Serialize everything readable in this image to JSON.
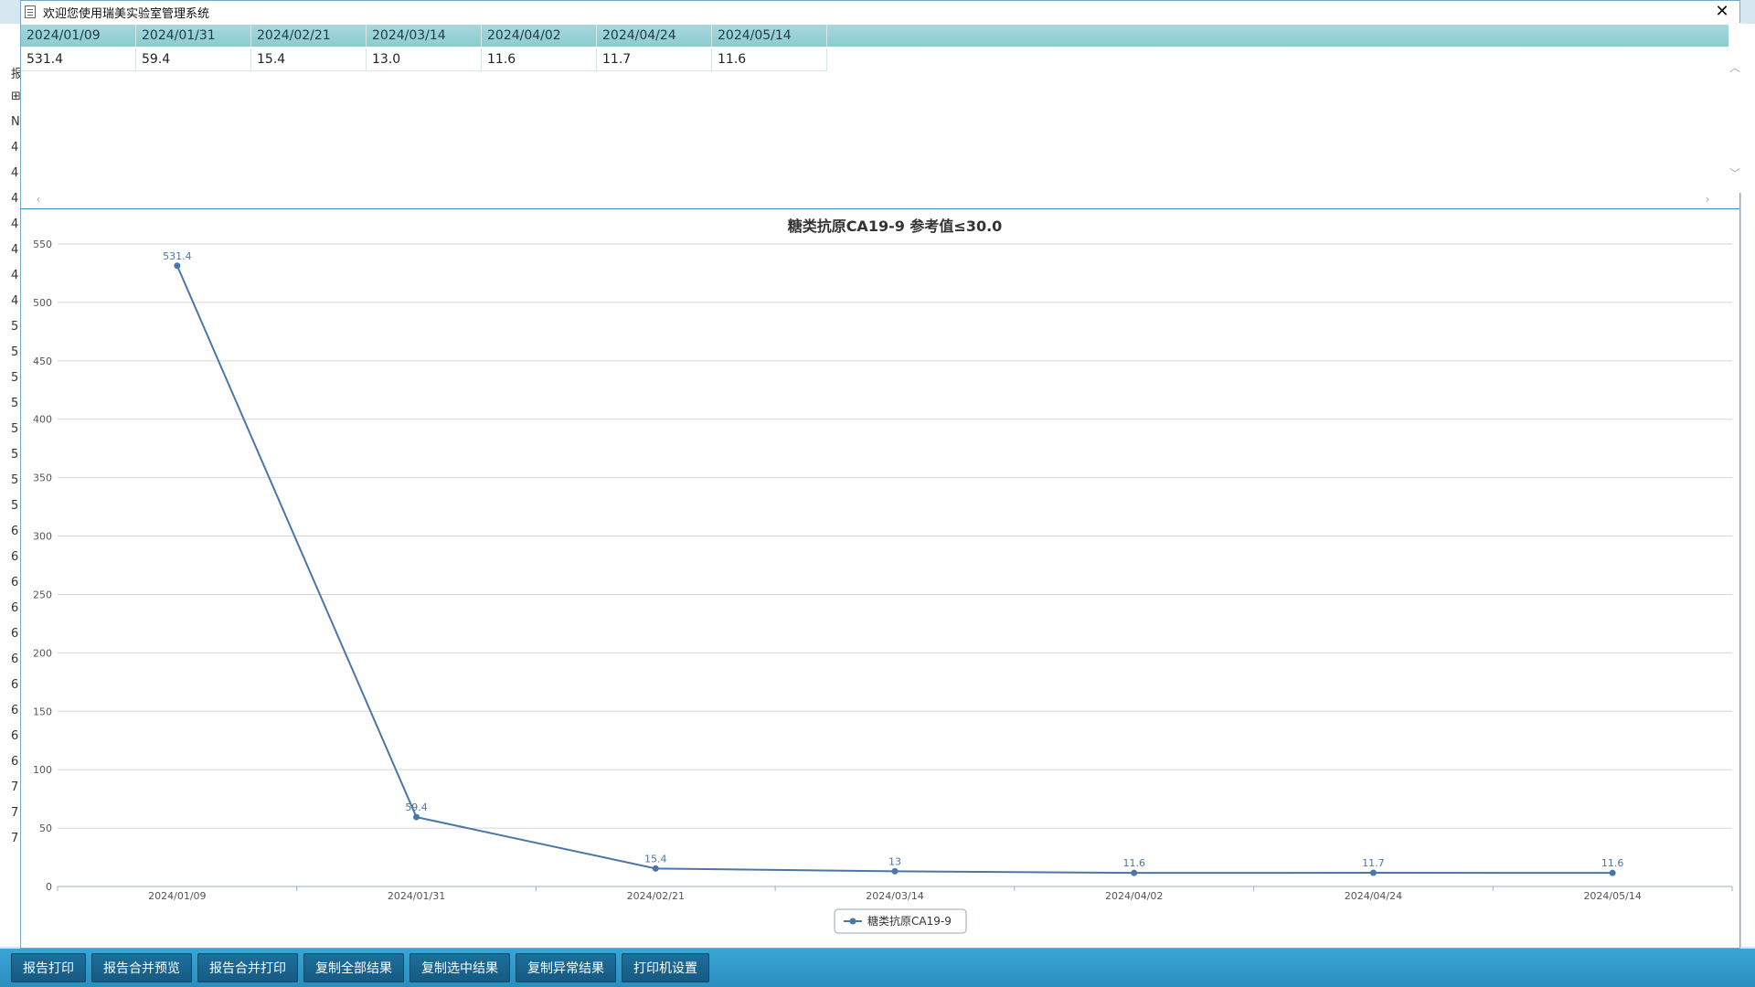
{
  "dialog": {
    "title": "欢迎您使用瑞美实验室管理系统",
    "close_glyph": "✕"
  },
  "table": {
    "columns": [
      "2024/01/09",
      "2024/01/31",
      "2024/02/21",
      "2024/03/14",
      "2024/04/02",
      "2024/04/24",
      "2024/05/14"
    ],
    "rows": [
      [
        "531.4",
        "59.4",
        "15.4",
        "13.0",
        "11.6",
        "11.7",
        "11.6"
      ]
    ]
  },
  "chart_data": {
    "type": "line",
    "title": "糖类抗原CA19-9 参考值≤30.0",
    "categories": [
      "2024/01/09",
      "2024/01/31",
      "2024/02/21",
      "2024/03/14",
      "2024/04/02",
      "2024/04/24",
      "2024/05/14"
    ],
    "series": [
      {
        "name": "糖类抗原CA19-9",
        "values": [
          531.4,
          59.4,
          15.4,
          13,
          11.6,
          11.7,
          11.6
        ],
        "labels": [
          "531.4",
          "59.4",
          "15.4",
          "13",
          "11.6",
          "11.7",
          "11.6"
        ]
      }
    ],
    "ylim": [
      0,
      550
    ],
    "yticks": [
      0,
      50,
      100,
      150,
      200,
      250,
      300,
      350,
      400,
      450,
      500,
      550
    ],
    "grid": true,
    "legend": "bottom-center",
    "line_color": "#4a76a8"
  },
  "bottom_toolbar": {
    "buttons": [
      "报告打印",
      "报告合并预览",
      "报告合并打印",
      "复制全部结果",
      "复制选中结果",
      "复制异常结果",
      "打印机设置"
    ]
  },
  "background": {
    "left_rows": [
      "报",
      "⊞",
      "N",
      "4",
      "4",
      "4",
      "4",
      "4",
      "4",
      "4",
      "5",
      "5",
      "5",
      "5",
      "5",
      "5",
      "5",
      "5",
      "6",
      "6",
      "6",
      "6",
      "6",
      "6",
      "6",
      "6",
      "6",
      "6",
      "7",
      "7",
      "7"
    ]
  },
  "colors": {
    "header": "#8ccbd0",
    "accent": "#2a8fbf",
    "button": "#165a82"
  }
}
